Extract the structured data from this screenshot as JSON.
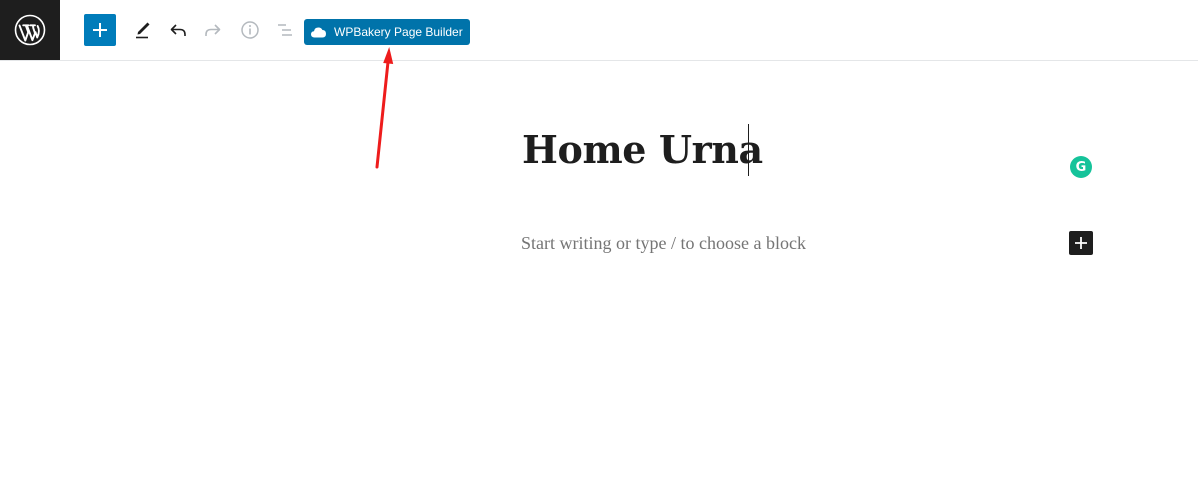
{
  "toolbar": {
    "logo_icon": "wordpress-logo-icon",
    "add_block_icon": "plus-icon",
    "tools_icon": "pencil-icon",
    "undo_icon": "undo-icon",
    "redo_icon": "redo-icon",
    "details_icon": "info-icon",
    "outline_icon": "list-view-icon",
    "wpbakery_label": "WPBakery Page Builder",
    "wpbakery_icon": "cloud-icon",
    "accent_color": "#007cba",
    "wpbakery_color": "#0073aa"
  },
  "editor": {
    "title": "Home Urna",
    "placeholder": "Start writing or type / to choose a block",
    "grammarly_letter": "G",
    "grammarly_color": "#15c39a",
    "inline_add_icon": "plus-icon"
  },
  "annotation": {
    "arrow_color": "#ee1c1c"
  }
}
